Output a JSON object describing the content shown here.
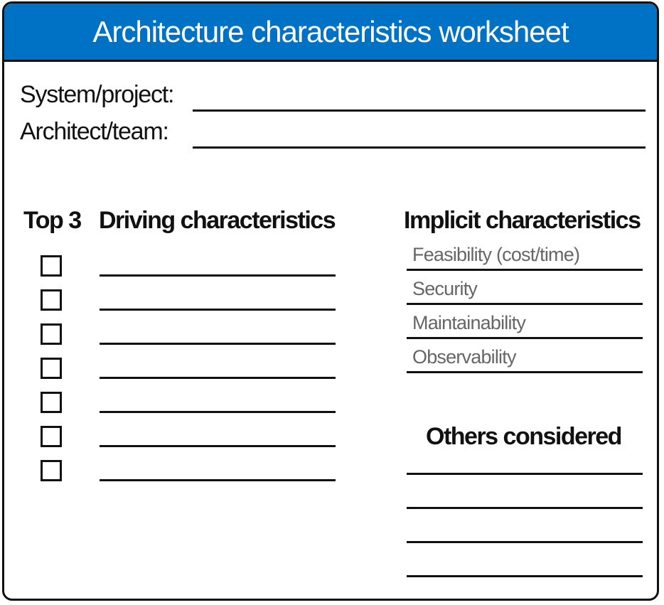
{
  "header": {
    "title": "Architecture characteristics worksheet"
  },
  "fields": {
    "system_label": "System/project:",
    "architect_label": "Architect/team:"
  },
  "columns": {
    "top3_heading": "Top 3",
    "driving_heading": "Driving characteristics",
    "implicit_heading": "Implicit characteristics",
    "others_heading": "Others considered"
  },
  "implicit_items": [
    "Feasibility (cost/time)",
    "Security",
    "Maintainability",
    "Observability"
  ],
  "colors": {
    "header_bg": "#0072c6",
    "header_text": "#ffffff",
    "border": "#111111",
    "implicit_text": "#666666"
  }
}
